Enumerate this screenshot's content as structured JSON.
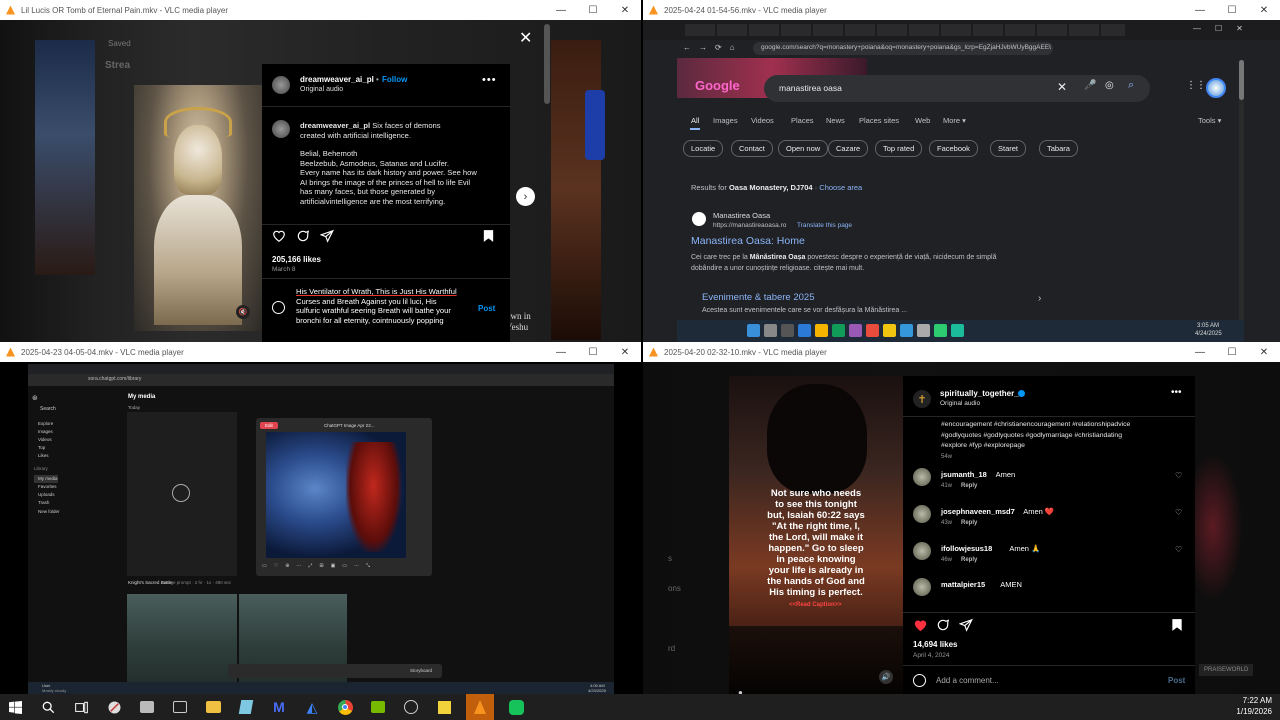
{
  "win1": {
    "title": "Lil Lucis OR Tomb of Eternal Pain.mkv - VLC media player",
    "bg_saved": "Saved",
    "bg_stream": "Strea",
    "username": "dreamweaver_ai_pl",
    "follow": "Follow",
    "dot": "•",
    "audio": "Original audio",
    "caption_user": "dreamweaver_ai_pl",
    "caption_l1": "Six faces of demons",
    "caption_l2": "created with artificial intelligence.",
    "caption_l3": "Belial, Behemoth",
    "caption_l4": "Beelzebub, Asmodeus, Satanas and Lucifer.",
    "caption_l5": "Every name has its dark history and power. See how",
    "caption_l6": "AI brings the image of the princes of hell to life Evil",
    "caption_l7": "has many faces, but those generated by",
    "caption_l8": "artificialvintelligence are the most terrifying.",
    "likes": "205,166 likes",
    "date": "March 8",
    "comment_l1": "His Ventilator of Wrath, This is Just His Warthful",
    "comment_l2": "Curses and Breath Against you lil luci, His",
    "comment_l3": "sulfuric wrathful seering Breath will bathe your",
    "comment_l4": "bronchi for all eternity, cointnuously popping",
    "post": "Post",
    "side_text1": "own in",
    "side_text2": "Yeshu"
  },
  "win2": {
    "title": "2025-04-24 01-54-56.mkv - VLC media player",
    "url": "google.com/search?q=monastery+poiana&oq=monastery+poiana&gs_lcrp=EgZjaHJvbWUyBggAEEUYOTI...",
    "logo": "Google",
    "query": "manastirea oasa",
    "tabs": [
      "All",
      "Images",
      "Videos",
      "Places",
      "News",
      "Places sites",
      "Web",
      "More ▾"
    ],
    "tools": "Tools ▾",
    "chips": [
      "Locatie",
      "Contact",
      "Open now",
      "Cazare",
      "Top rated",
      "Facebook",
      "Staret",
      "Tabara"
    ],
    "results_for": "Results for",
    "results_place": "Oasa Monastery, DJ704",
    "choose_area": "Choose area",
    "site_name": "Manastirea Oasa",
    "site_url": "https://manastireaoasa.ro",
    "translate": "Translate this page",
    "result_title": "Manastirea Oasa: Home",
    "snippet1_a": "Cei care trec pe la",
    "snippet1_b": "Mânăstirea Oașa",
    "snippet1_c": "povestesc despre o experiență de viață, nicidecum de simplă",
    "snippet2": "dobândire a unor cunoștințe religioase. citește mai mult.",
    "events_title": "Evenimente & tabere 2025",
    "events_snippet": "Acestea sunt evenimentele care se vor desfășura la Mănăstirea ...",
    "clock_time": "3:05 AM",
    "clock_date": "4/24/2025"
  },
  "win3": {
    "title": "2025-04-23 04-05-04.mkv - VLC media player",
    "url": "sora.chatgpt.com/library",
    "page_title": "My media",
    "subtitle": "Today",
    "sidebar_search": "Search",
    "sidebar": [
      "Explore",
      "Images",
      "Videos",
      "Top",
      "Likes"
    ],
    "sidebar_library": "Library",
    "library_items": [
      "My media",
      "Favorites",
      "Uploads",
      "Trash"
    ],
    "new_folder": "New folder",
    "modal_title": "ChatGPT Image Apr 22...",
    "modal_badge": "Edit",
    "caption_prompt": "Knight's Sacred Battle",
    "caption_meta": "Image prompt · 2 hr · 1x · 480 sec",
    "storyboard": "Storyboard",
    "taskbar_user": "User",
    "taskbar_sub": "Mostly cloudy",
    "taskbar_time": "4:05 AM",
    "taskbar_date": "4/23/2025"
  },
  "win4": {
    "title": "2025-04-20 02-32-10.mkv - VLC media player",
    "username": "spiritually_together_",
    "audio": "Original audio",
    "hashtags_l1": "#encouragement #christianencouragement #relationshipadvice",
    "hashtags_l2": "#godlyquotes #godlyquotes #godlymarriage #christiandating",
    "hashtags_l3": "#explore #fyp #explorepage",
    "age": "54w",
    "quote_l1": "Not sure who needs",
    "quote_l2": "to see this tonight",
    "quote_l3": "but, Isaiah 60:22 says",
    "quote_l4": "\"At the right time, I,",
    "quote_l5": "the Lord, will make it",
    "quote_l6": "happen.\" Go to sleep",
    "quote_l7": "in peace knowing",
    "quote_l8": "your life is already in",
    "quote_l9": "the hands of God and",
    "quote_l10": "His timing is perfect.",
    "read_caption": "<<Read Caption>>",
    "comments": [
      {
        "user": "jsumanth_18",
        "text": "Amen",
        "time": "41w",
        "reply": "Reply"
      },
      {
        "user": "josephnaveen_msd7",
        "text": "Amen ❤️",
        "time": "43w",
        "reply": "Reply"
      },
      {
        "user": "ifollowjesus18",
        "text": "Amen 🙏",
        "time": "46w",
        "reply": "Reply"
      },
      {
        "user": "mattalpier15",
        "text": "AMEN",
        "time": "",
        "reply": ""
      }
    ],
    "likes": "14,694 likes",
    "date": "April 4, 2024",
    "add_comment": "Add a comment...",
    "post": "Post",
    "side_letters": [
      "s",
      "ons",
      "rd"
    ],
    "watermark": "PRAISEWORLD"
  },
  "taskbar": {
    "time": "7:22 AM",
    "date": "1/19/2026"
  },
  "colors": {
    "ig_blue": "#0095f6",
    "google_link": "#8ab4f8",
    "heart_red": "#ff3040",
    "vlc_orange": "#f7931e"
  }
}
